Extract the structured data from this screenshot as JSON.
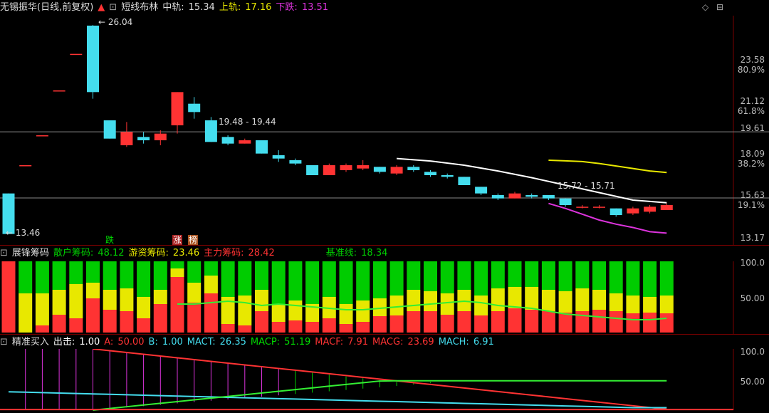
{
  "main_header": {
    "stock": "无锡振华(日线,前复权)",
    "indicator": "短线布林",
    "mid_label": "中轨:",
    "mid_value": "15.34",
    "upper_label": "上轨:",
    "upper_value": "17.16",
    "lower_label": "下跌:",
    "lower_value": "13.51"
  },
  "chip_header": {
    "name": "展锋筹码",
    "retail_label": "散户筹码:",
    "retail_value": "48.12",
    "hot_label": "游资筹码:",
    "hot_value": "23.46",
    "main_label": "主力筹码:",
    "main_value": "28.42",
    "base_label": "基准线:",
    "base_value": "18.34"
  },
  "macd_header": {
    "name": "精准买入",
    "out_label": "出击:",
    "out_value": "1.00",
    "a_label": "A:",
    "a_value": "50.00",
    "b_label": "B:",
    "b_value": "1.00",
    "macT_label": "MACT:",
    "macT_value": "26.35",
    "macP_label": "MACP:",
    "macP_value": "51.19",
    "macF_label": "MACF:",
    "macF_value": "7.91",
    "macG_label": "MACG:",
    "macG_value": "23.69",
    "macH_label": "MACH:",
    "macH_value": "6.91"
  },
  "price_axis": [
    "23.58",
    "80.9%",
    "21.12",
    "61.8%",
    "19.61",
    "18.09",
    "38.2%",
    "15.63",
    "19.1%",
    "13.17"
  ],
  "chip_axis": [
    "100.0",
    "50.00"
  ],
  "macd_axis": [
    "100.0",
    "50.00"
  ],
  "annotations": {
    "high": "26.04",
    "low": "13.46",
    "range1": "19.48 - 19.44",
    "range2": "15.72 - 15.71",
    "tag_fall": "跌",
    "tag_rise": "涨",
    "tag_list": "榜"
  },
  "colors": {
    "up": "#ff3333",
    "down": "#44ddee",
    "yellow": "#e8e800",
    "green": "#00cc00",
    "magenta": "#dd33dd"
  },
  "chart_data": {
    "type": "candlestick",
    "candles": [
      {
        "o": 15.9,
        "c": 13.46,
        "h": 15.9,
        "l": 13.46
      },
      {
        "o": 17.6,
        "c": 17.6,
        "h": 17.6,
        "l": 17.6
      },
      {
        "o": 19.4,
        "c": 19.4,
        "h": 19.4,
        "l": 19.4
      },
      {
        "o": 22.1,
        "c": 22.1,
        "h": 22.1,
        "l": 22.1
      },
      {
        "o": 24.3,
        "c": 24.3,
        "h": 24.3,
        "l": 24.3
      },
      {
        "o": 26.0,
        "c": 22.0,
        "h": 26.04,
        "l": 21.6
      },
      {
        "o": 20.3,
        "c": 19.2,
        "h": 20.3,
        "l": 19.2
      },
      {
        "o": 18.8,
        "c": 19.6,
        "h": 20.2,
        "l": 18.7
      },
      {
        "o": 19.3,
        "c": 19.1,
        "h": 19.6,
        "l": 18.9
      },
      {
        "o": 19.1,
        "c": 19.5,
        "h": 19.7,
        "l": 18.8
      },
      {
        "o": 20.0,
        "c": 22.0,
        "h": 22.0,
        "l": 19.5
      },
      {
        "o": 21.3,
        "c": 20.8,
        "h": 21.7,
        "l": 20.4
      },
      {
        "o": 20.3,
        "c": 19.0,
        "h": 20.5,
        "l": 19.0
      },
      {
        "o": 19.3,
        "c": 18.9,
        "h": 19.4,
        "l": 18.8
      },
      {
        "o": 18.9,
        "c": 19.1,
        "h": 19.2,
        "l": 18.9
      },
      {
        "o": 19.1,
        "c": 18.3,
        "h": 19.1,
        "l": 18.3
      },
      {
        "o": 18.2,
        "c": 18.0,
        "h": 18.5,
        "l": 17.8
      },
      {
        "o": 17.9,
        "c": 17.7,
        "h": 18.0,
        "l": 17.6
      },
      {
        "o": 17.6,
        "c": 17.0,
        "h": 17.6,
        "l": 17.0
      },
      {
        "o": 17.0,
        "c": 17.6,
        "h": 17.7,
        "l": 17.0
      },
      {
        "o": 17.3,
        "c": 17.6,
        "h": 17.7,
        "l": 17.2
      },
      {
        "o": 17.4,
        "c": 17.6,
        "h": 17.9,
        "l": 17.3
      },
      {
        "o": 17.5,
        "c": 17.2,
        "h": 17.5,
        "l": 17.1
      },
      {
        "o": 17.1,
        "c": 17.5,
        "h": 17.6,
        "l": 17.0
      },
      {
        "o": 17.5,
        "c": 17.3,
        "h": 17.6,
        "l": 17.2
      },
      {
        "o": 17.2,
        "c": 17.0,
        "h": 17.3,
        "l": 16.9
      },
      {
        "o": 17.0,
        "c": 16.9,
        "h": 17.1,
        "l": 16.8
      },
      {
        "o": 16.9,
        "c": 16.4,
        "h": 16.9,
        "l": 16.4
      },
      {
        "o": 16.3,
        "c": 15.9,
        "h": 16.3,
        "l": 15.8
      },
      {
        "o": 15.8,
        "c": 15.6,
        "h": 15.9,
        "l": 15.5
      },
      {
        "o": 15.6,
        "c": 15.9,
        "h": 16.0,
        "l": 15.6
      },
      {
        "o": 15.8,
        "c": 15.7,
        "h": 15.9,
        "l": 15.6
      },
      {
        "o": 15.8,
        "c": 15.6,
        "h": 15.8,
        "l": 15.5
      },
      {
        "o": 15.6,
        "c": 15.2,
        "h": 15.6,
        "l": 15.1
      },
      {
        "o": 15.1,
        "c": 15.1,
        "h": 15.2,
        "l": 15.0
      },
      {
        "o": 15.1,
        "c": 15.1,
        "h": 15.2,
        "l": 15.0
      },
      {
        "o": 15.0,
        "c": 14.6,
        "h": 15.0,
        "l": 14.5
      },
      {
        "o": 14.7,
        "c": 15.0,
        "h": 15.1,
        "l": 14.6
      },
      {
        "o": 14.8,
        "c": 15.1,
        "h": 15.2,
        "l": 14.7
      },
      {
        "o": 14.9,
        "c": 15.2,
        "h": 15.3,
        "l": 14.9
      }
    ],
    "boll_upper": [
      [
        32,
        17.9
      ],
      [
        33,
        17.86
      ],
      [
        34,
        17.82
      ],
      [
        35,
        17.7
      ],
      [
        36,
        17.55
      ],
      [
        37,
        17.4
      ],
      [
        38,
        17.25
      ],
      [
        39,
        17.16
      ]
    ],
    "boll_mid": [
      [
        23,
        18.0
      ],
      [
        25,
        17.85
      ],
      [
        27,
        17.6
      ],
      [
        29,
        17.25
      ],
      [
        31,
        16.85
      ],
      [
        33,
        16.4
      ],
      [
        35,
        15.95
      ],
      [
        37,
        15.5
      ],
      [
        39,
        15.34
      ]
    ],
    "boll_lower": [
      [
        32,
        15.3
      ],
      [
        33,
        15.0
      ],
      [
        34,
        14.65
      ],
      [
        35,
        14.3
      ],
      [
        36,
        14.05
      ],
      [
        37,
        13.85
      ],
      [
        38,
        13.6
      ],
      [
        39,
        13.51
      ]
    ],
    "ylim": [
      12.8,
      26.6
    ]
  },
  "chip_data": {
    "retail": [
      0,
      45,
      45,
      40,
      32,
      30,
      40,
      38,
      50,
      40,
      10,
      30,
      20,
      50,
      48,
      40,
      60,
      55,
      60,
      50,
      60,
      55,
      52,
      48,
      40,
      42,
      45,
      40,
      48,
      38,
      36,
      36,
      40,
      42,
      38,
      40,
      45,
      48,
      50,
      48
    ],
    "hot": [
      0,
      55,
      45,
      35,
      48,
      22,
      28,
      32,
      30,
      20,
      12,
      28,
      25,
      38,
      42,
      30,
      25,
      28,
      25,
      30,
      28,
      30,
      25,
      28,
      30,
      28,
      30,
      30,
      28,
      32,
      30,
      32,
      30,
      30,
      32,
      28,
      25,
      25,
      22,
      25
    ],
    "baseline": [
      0,
      0,
      0,
      0,
      0,
      0,
      0,
      0,
      0,
      0,
      40,
      40,
      42,
      44,
      42,
      38,
      40,
      38,
      36,
      34,
      32,
      32,
      34,
      36,
      38,
      40,
      42,
      44,
      42,
      38,
      36,
      34,
      30,
      26,
      24,
      22,
      20,
      18,
      18,
      20
    ]
  }
}
